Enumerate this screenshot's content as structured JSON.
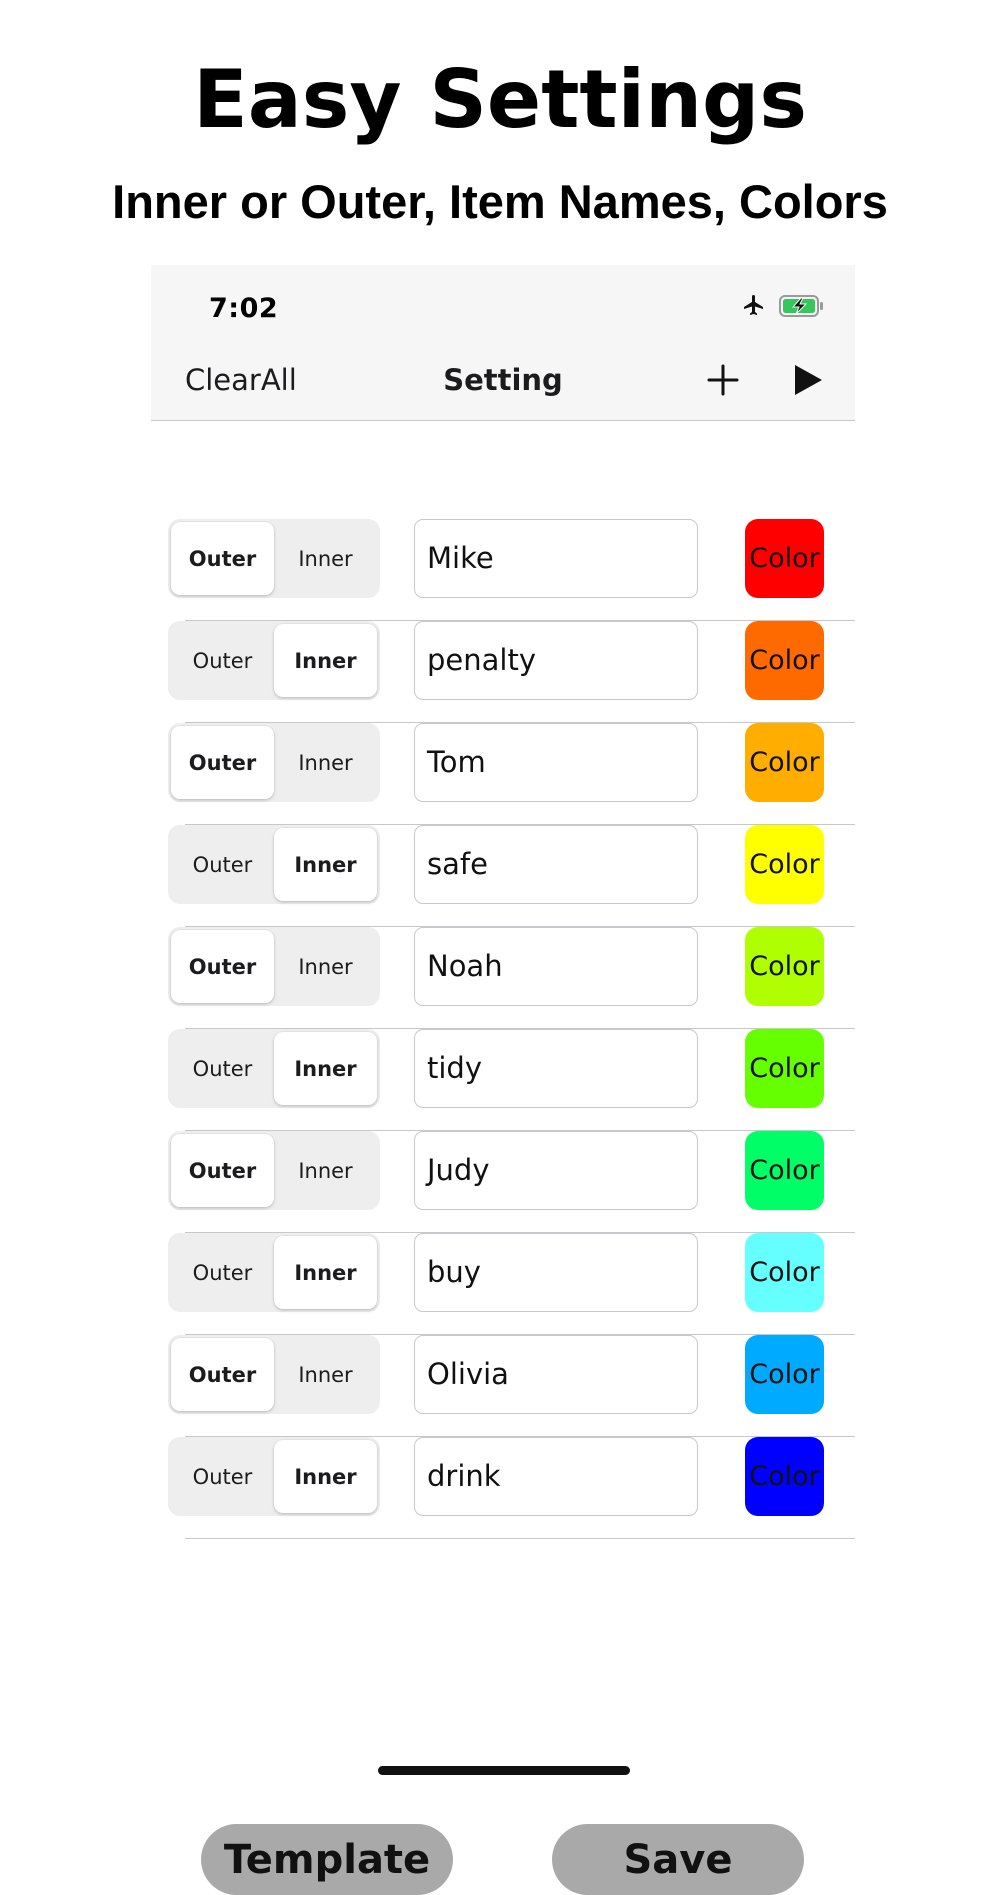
{
  "hero": {
    "title": "Easy Settings",
    "subtitle": "Inner or Outer, Item Names, Colors"
  },
  "status_bar": {
    "time": "7:02",
    "icons": [
      "airplane-icon",
      "battery-charging-icon"
    ],
    "battery_color": "#34c759"
  },
  "navbar": {
    "left_label": "ClearAll",
    "title": "Setting",
    "right_icons": [
      "plus-icon",
      "play-icon"
    ]
  },
  "segment_labels": {
    "outer": "Outer",
    "inner": "Inner"
  },
  "items": [
    {
      "mode": "Outer",
      "name": "Mike",
      "color_label": "Color",
      "color": "#ff0000"
    },
    {
      "mode": "Inner",
      "name": "penalty",
      "color_label": "Color",
      "color": "#ff6a00"
    },
    {
      "mode": "Outer",
      "name": "Tom",
      "color_label": "Color",
      "color": "#ffae00"
    },
    {
      "mode": "Inner",
      "name": "safe",
      "color_label": "Color",
      "color": "#ffff00"
    },
    {
      "mode": "Outer",
      "name": "Noah",
      "color_label": "Color",
      "color": "#b0ff00"
    },
    {
      "mode": "Inner",
      "name": "tidy",
      "color_label": "Color",
      "color": "#66ff00"
    },
    {
      "mode": "Outer",
      "name": "Judy",
      "color_label": "Color",
      "color": "#00ff66"
    },
    {
      "mode": "Inner",
      "name": "buy",
      "color_label": "Color",
      "color": "#66ffff"
    },
    {
      "mode": "Outer",
      "name": "Olivia",
      "color_label": "Color",
      "color": "#00aaff"
    },
    {
      "mode": "Inner",
      "name": "drink",
      "color_label": "Color",
      "color": "#0000ff"
    }
  ],
  "footer": {
    "template_label": "Template",
    "save_label": "Save"
  }
}
